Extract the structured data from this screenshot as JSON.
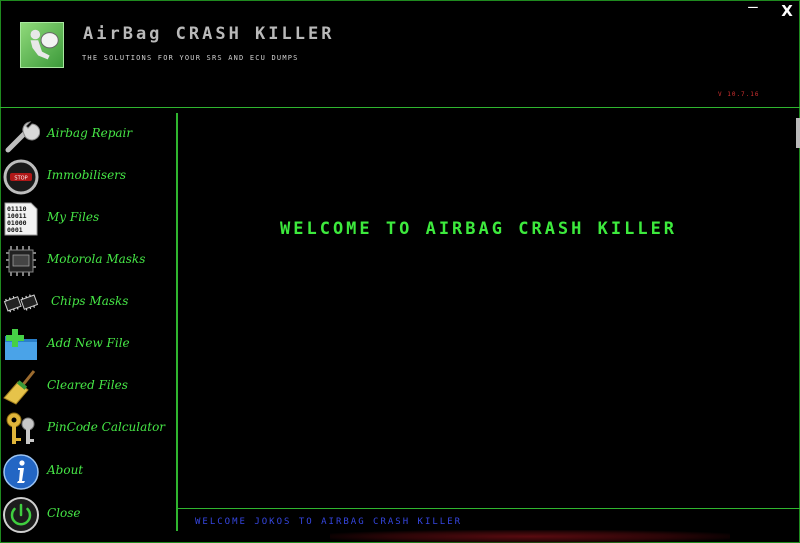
{
  "app": {
    "title": "AirBag CRASH KILLER",
    "subtitle": "THE SOLUTIONS FOR YOUR SRS AND ECU DUMPS",
    "version": "V 10.7.16"
  },
  "window": {
    "minimize_label": "—",
    "close_label": "X"
  },
  "sidebar": {
    "items": [
      {
        "label": "Airbag Repair",
        "icon": "wrench-icon"
      },
      {
        "label": "Immobilisers",
        "icon": "immobiliser-icon"
      },
      {
        "label": "My Files",
        "icon": "binary-file-icon"
      },
      {
        "label": "Motorola Masks",
        "icon": "cpu-chip-icon"
      },
      {
        "label": "Chips Masks",
        "icon": "chips-icon"
      },
      {
        "label": "Add New File",
        "icon": "add-folder-icon"
      },
      {
        "label": "Cleared Files",
        "icon": "broom-icon"
      },
      {
        "label": "PinCode Calculator",
        "icon": "keys-icon"
      },
      {
        "label": "About",
        "icon": "info-icon"
      },
      {
        "label": "Close",
        "icon": "power-icon"
      }
    ]
  },
  "main": {
    "welcome": "WELCOME TO AIRBAG CRASH KILLER"
  },
  "status": {
    "text": "WELCOME JOKOS TO AIRBAG CRASH KILLER"
  },
  "colors": {
    "accent": "#46e646",
    "border": "#2fb52f",
    "status": "#3546e0",
    "version": "#d03030"
  }
}
